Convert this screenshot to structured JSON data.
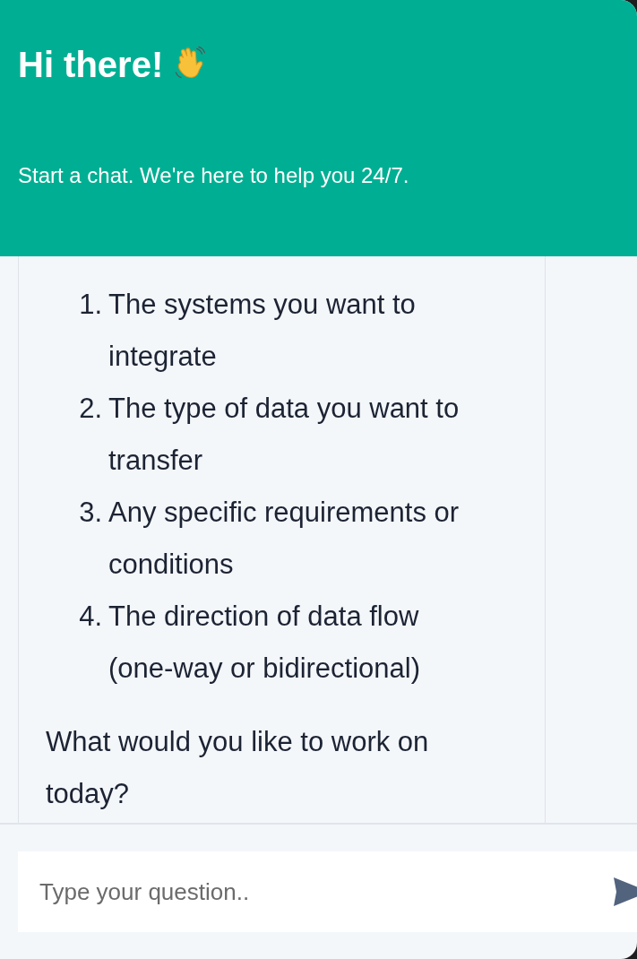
{
  "header": {
    "title": "Hi there!",
    "subtitle": "Start a chat. We're here to help you 24/7."
  },
  "message": {
    "list": [
      {
        "number": "1.",
        "text": "The systems you want to integrate"
      },
      {
        "number": "2.",
        "text": "The type of data you want to transfer"
      },
      {
        "number": "3.",
        "text": "Any specific requirements or conditions"
      },
      {
        "number": "4.",
        "text": "The direction of data flow (one-way or bidirectional)"
      }
    ],
    "question": "What would you like to work on today?"
  },
  "composer": {
    "placeholder": "Type your question.."
  }
}
